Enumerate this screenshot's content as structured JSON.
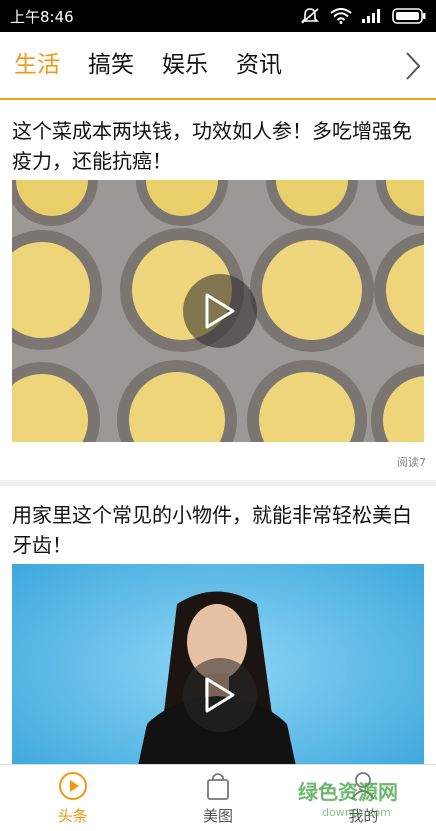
{
  "status_bar": {
    "time": "上午8:46"
  },
  "tabs": [
    {
      "label": "生活",
      "active": true
    },
    {
      "label": "搞笑",
      "active": false
    },
    {
      "label": "娱乐",
      "active": false
    },
    {
      "label": "资讯",
      "active": false
    }
  ],
  "articles": [
    {
      "title": "这个菜成本两块钱，功效如人参！多吃增强免疫力，还能抗癌！",
      "read_count": "阅读7"
    },
    {
      "title": "用家里这个常见的小物件，就能非常轻松美白牙齿！"
    }
  ],
  "bottom_nav": [
    {
      "label": "头条",
      "active": true
    },
    {
      "label": "美图",
      "active": false
    },
    {
      "label": "我的",
      "active": false
    }
  ],
  "watermark": {
    "text": "绿色资源网",
    "sub": "downcc.com"
  },
  "colors": {
    "accent": "#f29712",
    "tab_underline": "#f0a020"
  }
}
